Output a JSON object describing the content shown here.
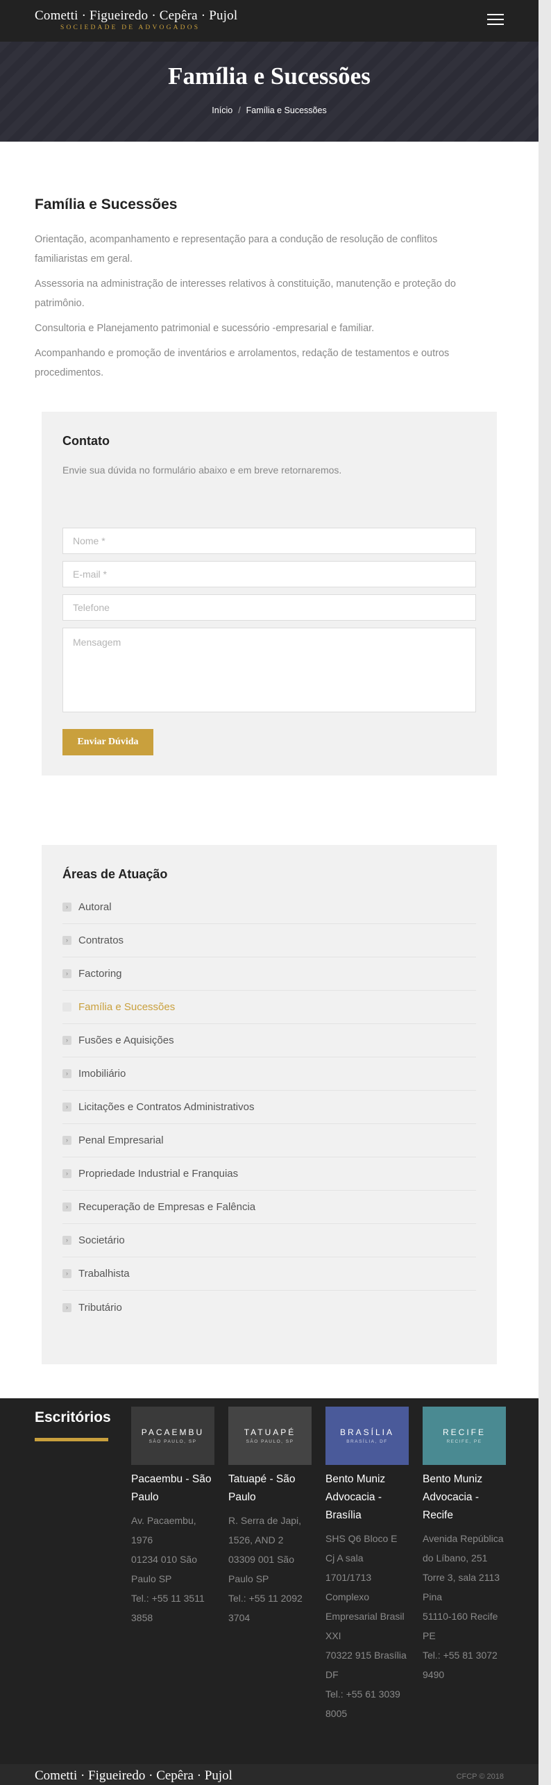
{
  "header": {
    "logo_main": "Cometti · Figueiredo · Cepêra · Pujol",
    "logo_sub": "SOCIEDADE DE ADVOGADOS"
  },
  "hero": {
    "title": "Família e Sucessões",
    "breadcrumb": {
      "home": "Início",
      "sep": "/",
      "current": "Família e Sucessões"
    }
  },
  "content": {
    "heading": "Família e Sucessões",
    "paragraphs": [
      "Orientação, acompanhamento e representação para a condução de resolução de conflitos familiaristas em geral.",
      "Assessoria na administração de interesses relativos à constituição, manutenção e proteção do patrimônio.",
      "Consultoria e Planejamento patrimonial e sucessório -empresarial e familiar.",
      "Acompanhando e promoção de inventários e arrolamentos, redação de testamentos e outros procedimentos."
    ]
  },
  "contact": {
    "title": "Contato",
    "lead": "Envie sua dúvida no formulário abaixo e em breve retornaremos.",
    "name_placeholder": "Nome *",
    "email_placeholder": "E-mail *",
    "phone_placeholder": "Telefone",
    "message_placeholder": "Mensagem",
    "submit": "Enviar Dúvida"
  },
  "areas": {
    "title": "Áreas de Atuação",
    "items": [
      "Autoral",
      "Contratos",
      "Factoring",
      "Família e Sucessões",
      "Fusões e Aquisições",
      "Imobiliário",
      "Licitações e Contratos Administrativos",
      "Penal Empresarial",
      "Propriedade Industrial e Franquias",
      "Recuperação de Empresas e Falência",
      "Societário",
      "Trabalhista",
      "Tributário"
    ],
    "active": "Família e Sucessões"
  },
  "footer": {
    "title": "Escritórios",
    "offices": [
      {
        "thumb_title": "PACAEMBU",
        "thumb_sub": "SÃO PAULO, SP",
        "name": "Pacaembu - São Paulo",
        "address": "Av. Pacaembu, 1976",
        "zip": "01234 010 São Paulo SP",
        "phone": "Tel.: +55 11 3511 3858",
        "color": "#3a3a3a"
      },
      {
        "thumb_title": "TATUAPÉ",
        "thumb_sub": "SÃO PAULO, SP",
        "name": "Tatuapé - São Paulo",
        "address": "R. Serra de Japi, 1526, AND 2",
        "zip": "03309 001 São Paulo SP",
        "phone": "Tel.: +55 11 2092 3704",
        "color": "#444444"
      },
      {
        "thumb_title": "BRASÍLIA",
        "thumb_sub": "BRASÍLIA, DF",
        "name": "Bento Muniz Advocacia - Brasília",
        "address": "SHS Q6 Bloco E Cj A sala 1701/1713 Complexo Empresarial Brasil XXI",
        "zip": "70322 915 Brasília DF",
        "phone": "Tel.: +55 61 3039 8005",
        "color": "#4a5a9a"
      },
      {
        "thumb_title": "RECIFE",
        "thumb_sub": "RECIFE, PE",
        "name": "Bento Muniz Advocacia - Recife",
        "address": "Avenida República do Líbano, 251 Torre 3, sala 2113 Pina",
        "zip": "51110-160 Recife PE",
        "phone": "Tel.: +55 81 3072 9490",
        "color": "#4a8a92"
      }
    ]
  },
  "bottom": {
    "logo": "Cometti · Figueiredo · Cepêra · Pujol",
    "copyright": "CFCP © 2018"
  }
}
